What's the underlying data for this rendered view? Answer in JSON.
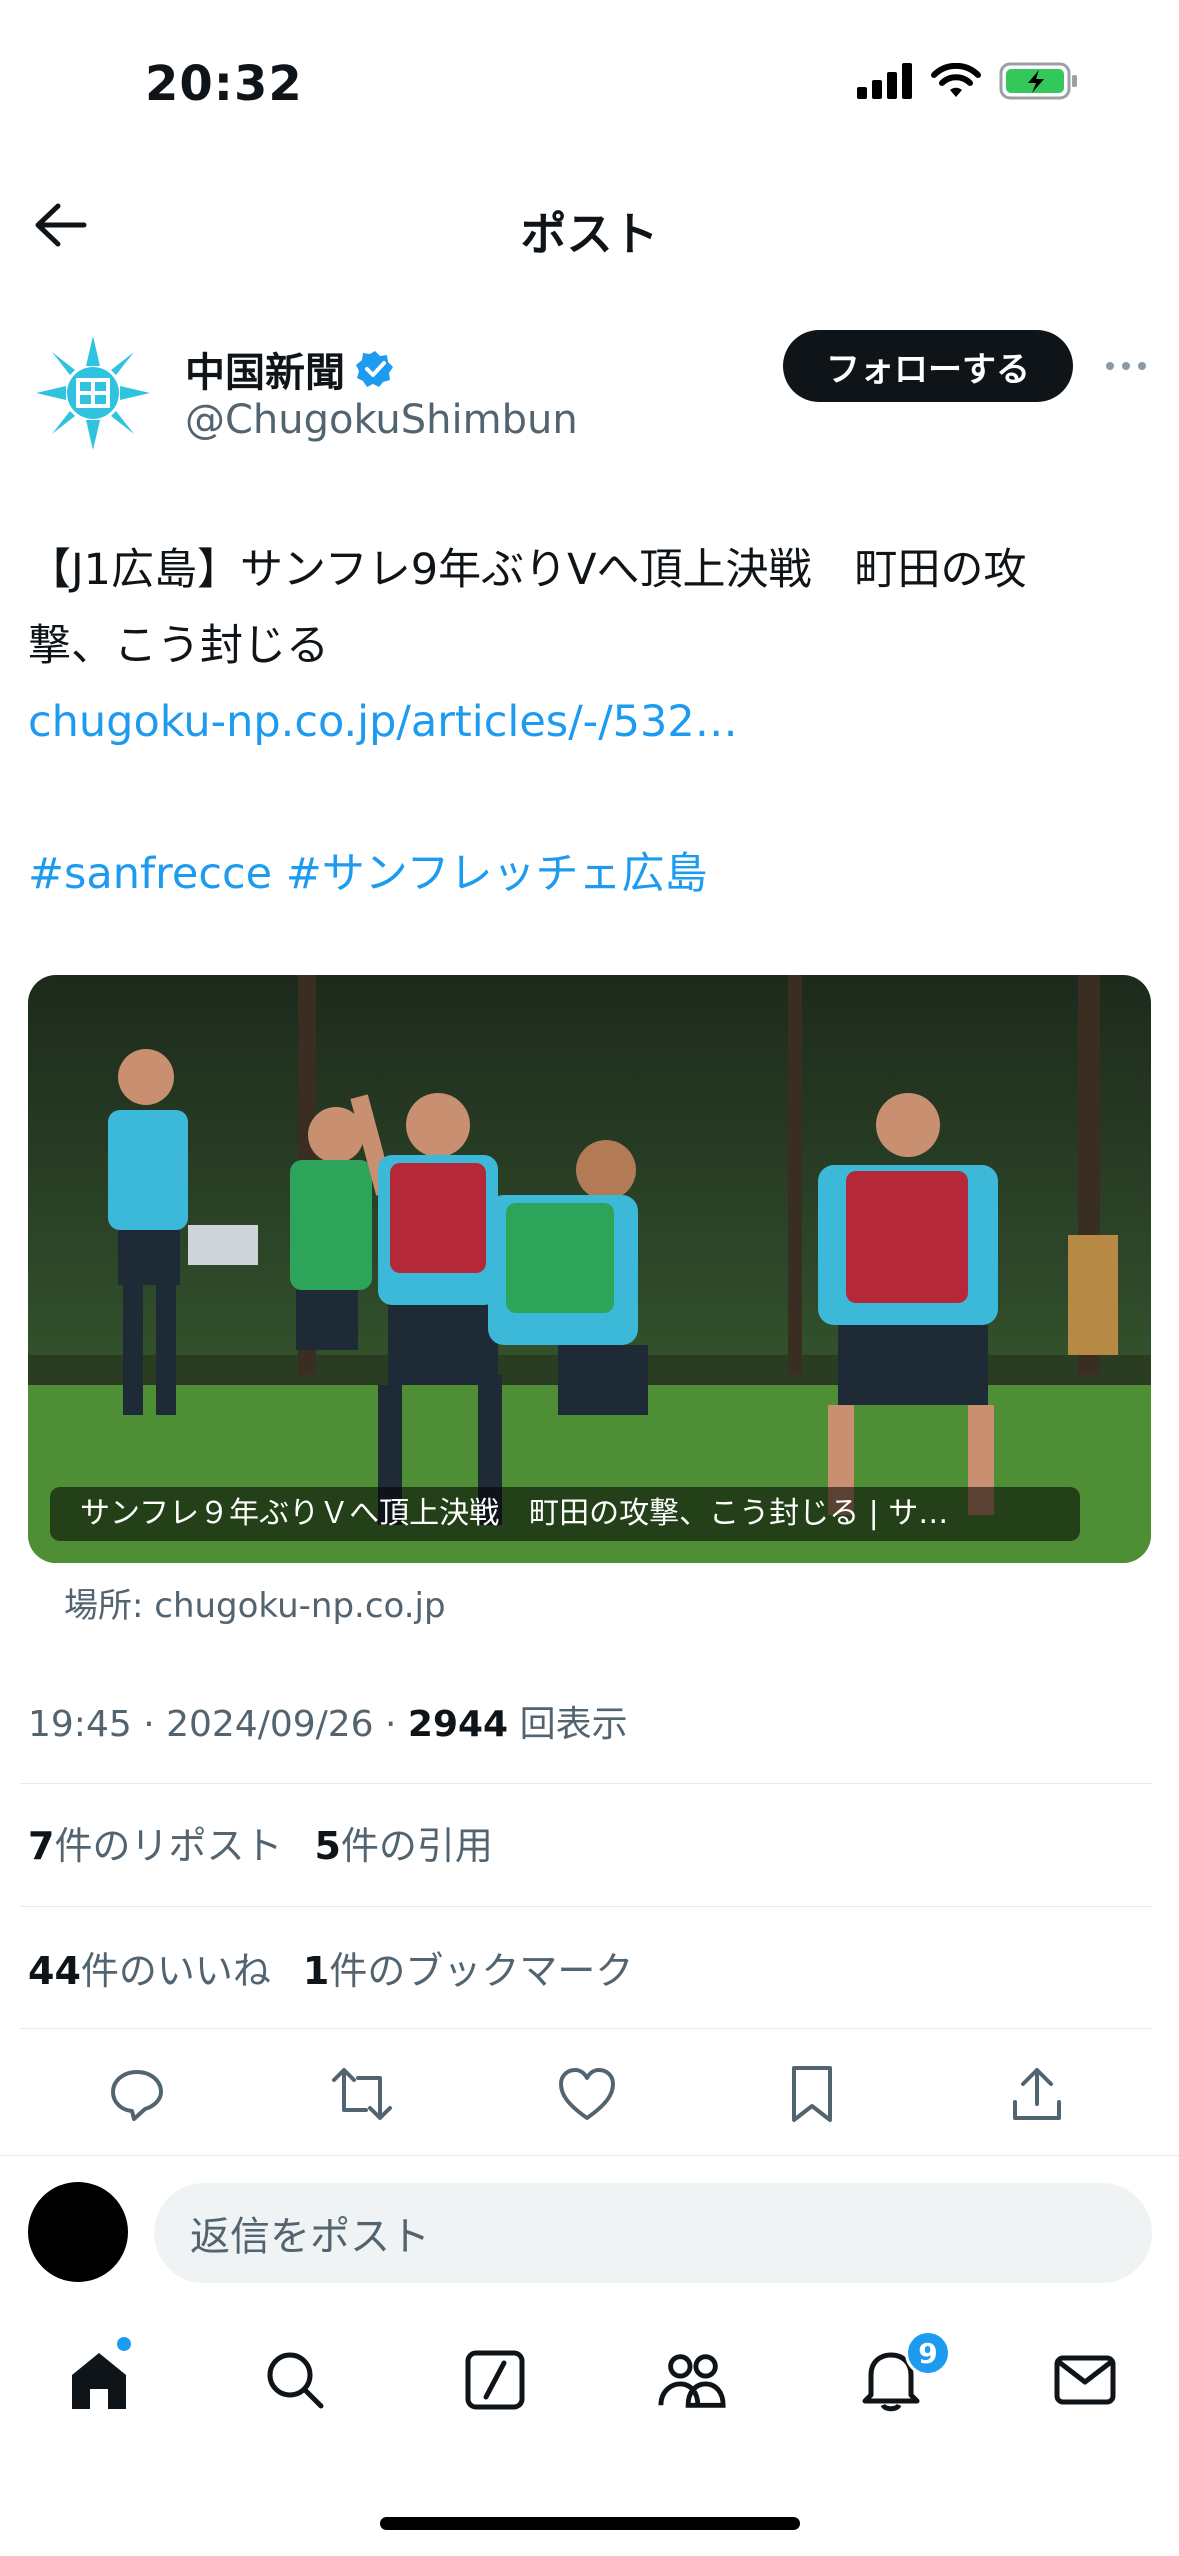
{
  "status_bar": {
    "time": "20:32"
  },
  "header": {
    "title": "ポスト"
  },
  "author": {
    "name": "中国新聞",
    "handle": "@ChugokuShimbun",
    "follow_label": "フォローする"
  },
  "tweet": {
    "text_line1": "【J1広島】サンフレ9年ぶりVへ頂上決戦　町田の攻",
    "text_line2": "撃、こう封じる",
    "link": "chugoku-np.co.jp/articles/-/532…",
    "hashtag1": "#sanfrecce",
    "hashtag2": "#サンフレッチェ広島"
  },
  "media": {
    "caption": "サンフレ９年ぶりＶへ頂上決戦　町田の攻撃、こう封じる | サ…",
    "source": "場所: chugoku-np.co.jp"
  },
  "meta": {
    "time_date": "19:45 · 2024/09/26 · ",
    "views_count": "2944",
    "views_label": "回表示"
  },
  "stats": {
    "reposts_count": "7",
    "reposts_label": "件のリポスト",
    "quotes_count": "5",
    "quotes_label": "件の引用",
    "likes_count": "44",
    "likes_label": "件のいいね",
    "bookmarks_count": "1",
    "bookmarks_label": "件のブックマーク"
  },
  "actions": [
    "reply-icon",
    "repost-icon",
    "like-icon",
    "bookmark-icon",
    "share-icon"
  ],
  "reply": {
    "placeholder": "返信をポスト"
  },
  "tab_bar": {
    "items": [
      "home-icon",
      "search-icon",
      "grok-icon",
      "communities-icon",
      "notifications-icon",
      "messages-icon"
    ],
    "notification_badge": "9"
  },
  "colors": {
    "accent": "#1d9bf0",
    "text": "#0f1419",
    "secondary": "#536471"
  }
}
